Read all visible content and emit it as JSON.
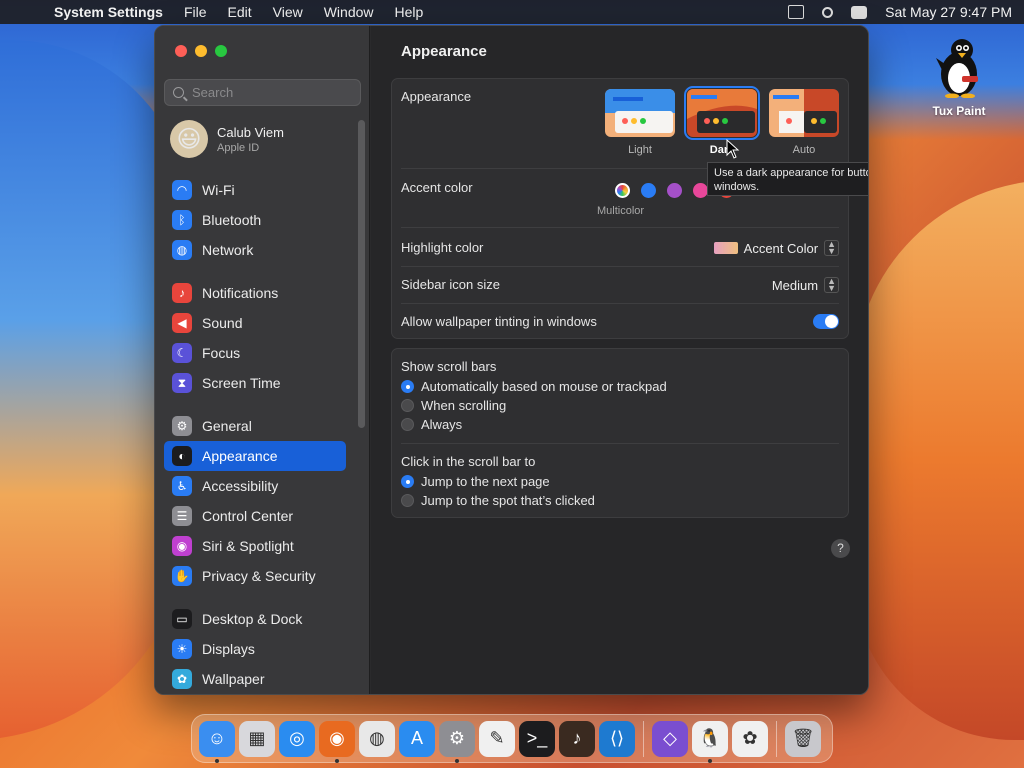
{
  "menubar": {
    "app_name": "System Settings",
    "menus": [
      "File",
      "Edit",
      "View",
      "Window",
      "Help"
    ],
    "clock": "Sat May 27  9:47 PM"
  },
  "desktop": {
    "icon_label": "Tux Paint"
  },
  "sidebar": {
    "search_placeholder": "Search",
    "profile_name": "Calub Viem",
    "profile_sub": "Apple ID",
    "groups": [
      [
        {
          "label": "Wi-Fi",
          "color": "#2a7cf4",
          "icon": "wifi-icon",
          "glyph": "◠"
        },
        {
          "label": "Bluetooth",
          "color": "#2a7cf4",
          "icon": "bluetooth-icon",
          "glyph": "ᛒ"
        },
        {
          "label": "Network",
          "color": "#2a7cf4",
          "icon": "globe-icon",
          "glyph": "◍"
        }
      ],
      [
        {
          "label": "Notifications",
          "color": "#e8453c",
          "icon": "bell-icon",
          "glyph": "♪"
        },
        {
          "label": "Sound",
          "color": "#e8453c",
          "icon": "speaker-icon",
          "glyph": "◀"
        },
        {
          "label": "Focus",
          "color": "#5a52d8",
          "icon": "moon-icon",
          "glyph": "☾"
        },
        {
          "label": "Screen Time",
          "color": "#5a52d8",
          "icon": "hourglass-icon",
          "glyph": "⧗"
        }
      ],
      [
        {
          "label": "General",
          "color": "#8e8e93",
          "icon": "gear-icon",
          "glyph": "⚙"
        },
        {
          "label": "Appearance",
          "color": "#1c1c1e",
          "icon": "appearance-icon",
          "glyph": "◐",
          "active": true
        },
        {
          "label": "Accessibility",
          "color": "#2a7cf4",
          "icon": "accessibility-icon",
          "glyph": "♿"
        },
        {
          "label": "Control Center",
          "color": "#8e8e93",
          "icon": "toggles-icon",
          "glyph": "☰"
        },
        {
          "label": "Siri & Spotlight",
          "color": "#c040d0",
          "icon": "siri-icon",
          "glyph": "◉"
        },
        {
          "label": "Privacy & Security",
          "color": "#2a7cf4",
          "icon": "hand-icon",
          "glyph": "✋"
        }
      ],
      [
        {
          "label": "Desktop & Dock",
          "color": "#1c1c1e",
          "icon": "dock-icon",
          "glyph": "▭"
        },
        {
          "label": "Displays",
          "color": "#2a7cf4",
          "icon": "display-icon",
          "glyph": "☀"
        },
        {
          "label": "Wallpaper",
          "color": "#34aadc",
          "icon": "wallpaper-icon",
          "glyph": "✿"
        }
      ]
    ]
  },
  "content": {
    "title": "Appearance",
    "appearance_label": "Appearance",
    "modes": [
      {
        "label": "Light",
        "selected": false
      },
      {
        "label": "Dark",
        "selected": true
      },
      {
        "label": "Auto",
        "selected": false
      }
    ],
    "accent_label": "Accent color",
    "accent_colors": [
      "multicolor",
      "#2a7cf4",
      "#a550c8",
      "#e8479a",
      "#e8453c"
    ],
    "accent_selected_label": "Multicolor",
    "tooltip": "Use a dark appearance for buttons, menus, and windows.",
    "highlight_label": "Highlight color",
    "highlight_value": "Accent Color",
    "sidebar_icon_label": "Sidebar icon size",
    "sidebar_icon_value": "Medium",
    "tinting_label": "Allow wallpaper tinting in windows",
    "tinting_on": true,
    "scroll_bars_label": "Show scroll bars",
    "scroll_bars_options": [
      {
        "label": "Automatically based on mouse or trackpad",
        "on": true
      },
      {
        "label": "When scrolling",
        "on": false
      },
      {
        "label": "Always",
        "on": false
      }
    ],
    "click_label": "Click in the scroll bar to",
    "click_options": [
      {
        "label": "Jump to the next page",
        "on": true
      },
      {
        "label": "Jump to the spot that’s clicked",
        "on": false
      }
    ],
    "help": "?"
  },
  "dock": {
    "apps": [
      {
        "name": "finder-icon",
        "color": "#3a8ef0",
        "glyph": "☺",
        "running": true
      },
      {
        "name": "launchpad-icon",
        "color": "#d8d8dc",
        "glyph": "▦",
        "running": false
      },
      {
        "name": "safari-icon",
        "color": "#2a8cf0",
        "glyph": "◎",
        "running": false
      },
      {
        "name": "firefox-icon",
        "color": "#e86a20",
        "glyph": "◉",
        "running": true
      },
      {
        "name": "chrome-icon",
        "color": "#e8e8e8",
        "glyph": "◍",
        "running": false
      },
      {
        "name": "app-store-icon",
        "color": "#2a8cf0",
        "glyph": "A",
        "running": false
      },
      {
        "name": "system-settings-icon",
        "color": "#8e8e93",
        "glyph": "⚙",
        "running": true
      },
      {
        "name": "textedit-icon",
        "color": "#f0f0f0",
        "glyph": "✎",
        "running": false
      },
      {
        "name": "terminal-icon",
        "color": "#1c1c1e",
        "glyph": ">_",
        "running": false
      },
      {
        "name": "instruments-icon",
        "color": "#3a2a20",
        "glyph": "♪",
        "running": false
      },
      {
        "name": "vscode-icon",
        "color": "#1e7ad0",
        "glyph": "⟨⟩",
        "running": false
      },
      {
        "name": "visual-studio-icon",
        "color": "#7a4ed0",
        "glyph": "◇",
        "running": false
      },
      {
        "name": "tux-paint-icon",
        "color": "#f0f0f0",
        "glyph": "🐧",
        "running": true
      },
      {
        "name": "photos-icon",
        "color": "#f0f0f0",
        "glyph": "✿",
        "running": false
      },
      {
        "name": "trash-icon",
        "color": "#c8c8cc",
        "glyph": "🗑",
        "running": false
      }
    ]
  }
}
